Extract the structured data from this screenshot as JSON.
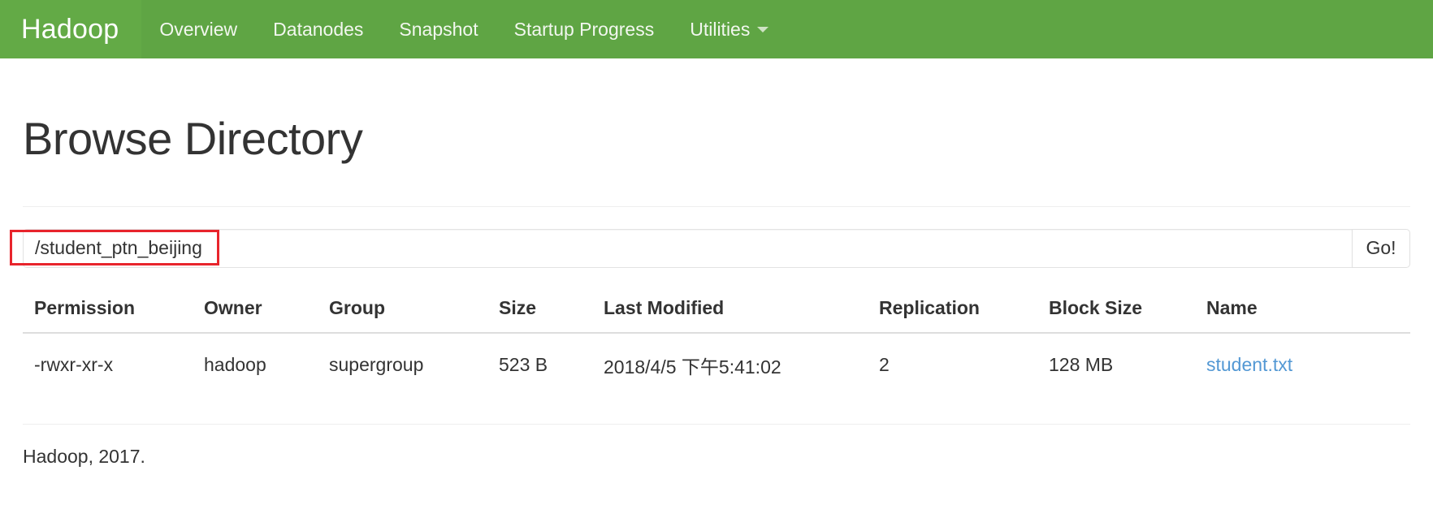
{
  "navbar": {
    "brand": "Hadoop",
    "brand_bg": "#63aa46",
    "bg": "#5fa544",
    "items": [
      {
        "label": "Overview",
        "icon": null
      },
      {
        "label": "Datanodes",
        "icon": null
      },
      {
        "label": "Snapshot",
        "icon": null
      },
      {
        "label": "Startup Progress",
        "icon": null
      },
      {
        "label": "Utilities",
        "icon": "chevron-down-icon"
      }
    ]
  },
  "page": {
    "title": "Browse Directory"
  },
  "path_form": {
    "value": "/student_ptn_beijing",
    "placeholder": "",
    "go_label": "Go!",
    "annotation_color": "#e8242c"
  },
  "table": {
    "columns": [
      "Permission",
      "Owner",
      "Group",
      "Size",
      "Last Modified",
      "Replication",
      "Block Size",
      "Name"
    ],
    "rows": [
      {
        "permission": "-rwxr-xr-x",
        "owner": "hadoop",
        "group": "supergroup",
        "size": "523 B",
        "last_modified": "2018/4/5 下午5:41:02",
        "replication": "2",
        "block_size": "128 MB",
        "name": "student.txt",
        "name_color": "#5398d4"
      }
    ]
  },
  "footer": {
    "text": "Hadoop, 2017."
  }
}
